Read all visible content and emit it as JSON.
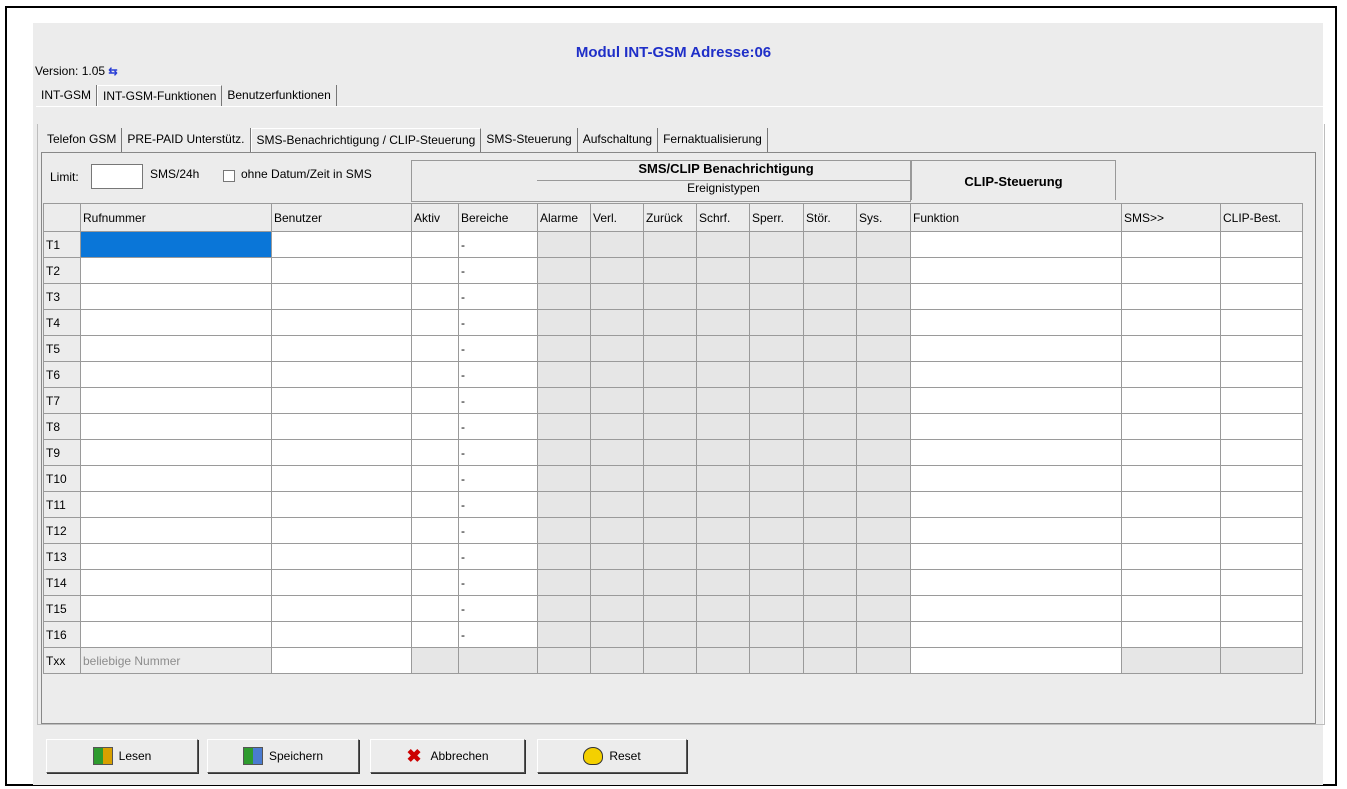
{
  "window": {
    "title": "Modul INT-GSM Adresse:06",
    "version_label": "Version: 1.05",
    "refresh_icon": "refresh-icon"
  },
  "tabs_main": [
    {
      "label": "INT-GSM",
      "active": false
    },
    {
      "label": "INT-GSM-Funktionen",
      "active": true
    },
    {
      "label": "Benutzerfunktionen",
      "active": false
    }
  ],
  "tabs_sub": [
    {
      "label": "Telefon GSM",
      "active": false
    },
    {
      "label": "PRE-PAID Unterstütz.",
      "active": false
    },
    {
      "label": "SMS-Benachrichtigung / CLIP-Steuerung",
      "active": true
    },
    {
      "label": "SMS-Steuerung",
      "active": false
    },
    {
      "label": "Aufschaltung",
      "active": false
    },
    {
      "label": "Fernaktualisierung",
      "active": false
    }
  ],
  "limit": {
    "label": "Limit:",
    "value": "",
    "unit": "SMS/24h",
    "checkbox_label": "ohne Datum/Zeit in SMS",
    "checked": false
  },
  "group_headers": {
    "sms_clip": "SMS/CLIP Benachrichtigung",
    "event_types": "Ereignistypen",
    "clip_control": "CLIP-Steuerung"
  },
  "columns": [
    "",
    "Rufnummer",
    "Benutzer",
    "Aktiv",
    "Bereiche",
    "Alarme",
    "Verl.",
    "Zurück",
    "Schrf.",
    "Sperr.",
    "Stör.",
    "Sys.",
    "Funktion",
    "SMS>>",
    "CLIP-Best."
  ],
  "rows": [
    {
      "id": "T1",
      "bereiche": "-"
    },
    {
      "id": "T2",
      "bereiche": "-"
    },
    {
      "id": "T3",
      "bereiche": "-"
    },
    {
      "id": "T4",
      "bereiche": "-"
    },
    {
      "id": "T5",
      "bereiche": "-"
    },
    {
      "id": "T6",
      "bereiche": "-"
    },
    {
      "id": "T7",
      "bereiche": "-"
    },
    {
      "id": "T8",
      "bereiche": "-"
    },
    {
      "id": "T9",
      "bereiche": "-"
    },
    {
      "id": "T10",
      "bereiche": "-"
    },
    {
      "id": "T11",
      "bereiche": "-"
    },
    {
      "id": "T12",
      "bereiche": "-"
    },
    {
      "id": "T13",
      "bereiche": "-"
    },
    {
      "id": "T14",
      "bereiche": "-"
    },
    {
      "id": "T15",
      "bereiche": "-"
    },
    {
      "id": "T16",
      "bereiche": "-"
    }
  ],
  "txx_row": {
    "id": "Txx",
    "rufnummer": "beliebige Nummer"
  },
  "buttons": {
    "read": {
      "label": "Lesen",
      "icon": "read-icon"
    },
    "save": {
      "label": "Speichern",
      "icon": "save-icon"
    },
    "cancel": {
      "label": "Abbrechen",
      "icon": "cancel-x-icon"
    },
    "reset": {
      "label": "Reset",
      "icon": "reset-icon"
    }
  }
}
